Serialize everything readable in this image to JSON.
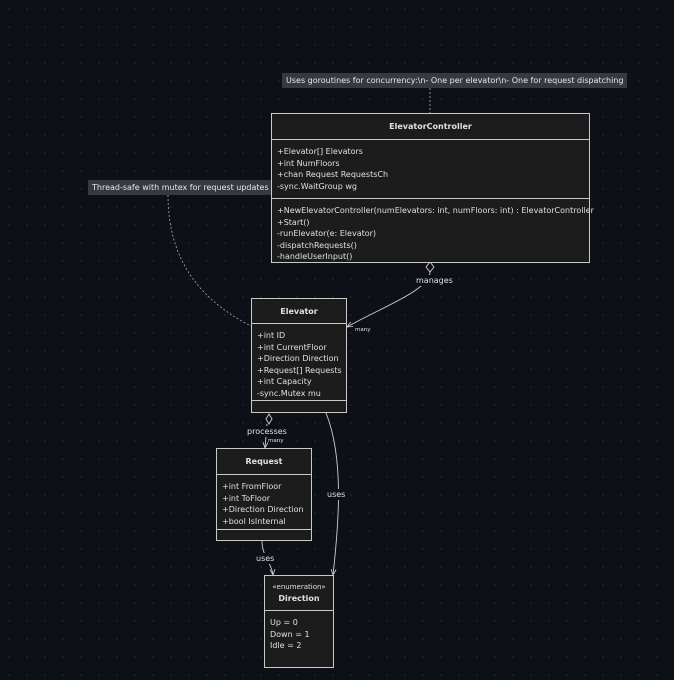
{
  "notes": {
    "concurrency": "Uses goroutines for concurrency:\\n- One per elevator\\n- One for request dispatching",
    "mutex": "Thread-safe with mutex for request updates"
  },
  "classes": {
    "controller": {
      "name": "ElevatorController",
      "attributes": [
        "+Elevator[] Elevators",
        "+int NumFloors",
        "+chan Request RequestsCh",
        "-sync.WaitGroup wg"
      ],
      "methods": [
        "+NewElevatorController(numElevators: int, numFloors: int) : ElevatorController",
        "+Start()",
        "-runElevator(e: Elevator)",
        "-dispatchRequests()",
        "-handleUserInput()"
      ]
    },
    "elevator": {
      "name": "Elevator",
      "attributes": [
        "+int ID",
        "+int CurrentFloor",
        "+Direction Direction",
        "+Request[] Requests",
        "+int Capacity",
        "-sync.Mutex mu"
      ],
      "methods": []
    },
    "request": {
      "name": "Request",
      "attributes": [
        "+int FromFloor",
        "+int ToFloor",
        "+Direction Direction",
        "+bool IsInternal"
      ],
      "methods": []
    },
    "direction": {
      "stereotype": "«enumeration»",
      "name": "Direction",
      "values": [
        "Up = 0",
        "Down = 1",
        "Idle = 2"
      ]
    }
  },
  "relations": {
    "manages": {
      "label": "manages",
      "multiplicity": "many"
    },
    "processes": {
      "label": "processes",
      "multiplicity": "many"
    },
    "elevator_uses": {
      "label": "uses"
    },
    "request_uses": {
      "label": "uses"
    }
  },
  "colors": {
    "background": "#0d1117",
    "box_fill": "#1c1c1c",
    "border": "#c9c9c9",
    "note_fill": "#353a40",
    "line": "#d0d0d0"
  }
}
